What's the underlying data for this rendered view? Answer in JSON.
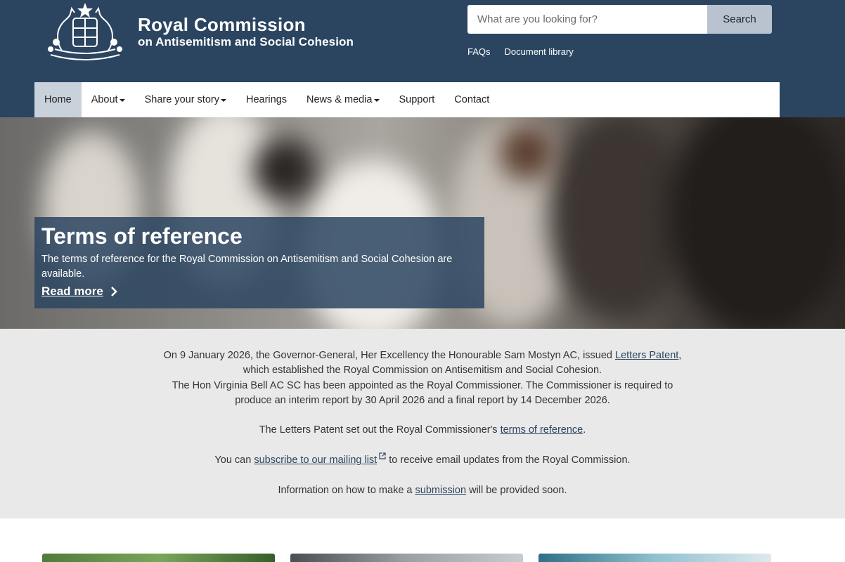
{
  "header": {
    "title": "Royal Commission",
    "subtitle": "on Antisemitism and Social Cohesion",
    "search_placeholder": "What are you looking for?",
    "search_button": "Search",
    "util_links": [
      "FAQs",
      "Document library"
    ]
  },
  "nav": {
    "items": [
      {
        "label": "Home",
        "active": true,
        "dropdown": false
      },
      {
        "label": "About",
        "active": false,
        "dropdown": true
      },
      {
        "label": "Share your story",
        "active": false,
        "dropdown": true
      },
      {
        "label": "Hearings",
        "active": false,
        "dropdown": false
      },
      {
        "label": "News & media",
        "active": false,
        "dropdown": true
      },
      {
        "label": "Support",
        "active": false,
        "dropdown": false
      },
      {
        "label": "Contact",
        "active": false,
        "dropdown": false
      }
    ]
  },
  "hero": {
    "title": "Terms of reference",
    "text": "The terms of reference for the Royal Commission on Antisemitism and Social Cohesion are available.",
    "link": "Read more"
  },
  "intro": {
    "p1_a": "On 9 January 2026, the Governor-General, Her Excellency the Honourable Sam Mostyn AC, issued ",
    "p1_link": "Letters Patent",
    "p1_b": ",",
    "p1_c": "which established the Royal Commission on Antisemitism and Social Cohesion.",
    "p2": "The Hon Virginia Bell AC SC has been appointed as the Royal Commissioner. The Commissioner is required to",
    "p2_b": "produce an interim report by 30 April 2026 and a final report by 14 December 2026.",
    "p3_a": "The Letters Patent set out the Royal Commissioner's ",
    "p3_link": "terms of reference",
    "p3_b": ".",
    "p4_a": "You can ",
    "p4_link": "subscribe to our mailing list",
    "p4_b": " to receive email updates from the Royal Commission.",
    "p5_a": "Information on how to make a ",
    "p5_link": "submission",
    "p5_b": " will be provided soon."
  },
  "colors": {
    "header_bg": "#2b4560",
    "nav_active": "#c9d1da",
    "intro_bg": "#e9e9e9",
    "search_button_bg": "#b8c3cf"
  }
}
